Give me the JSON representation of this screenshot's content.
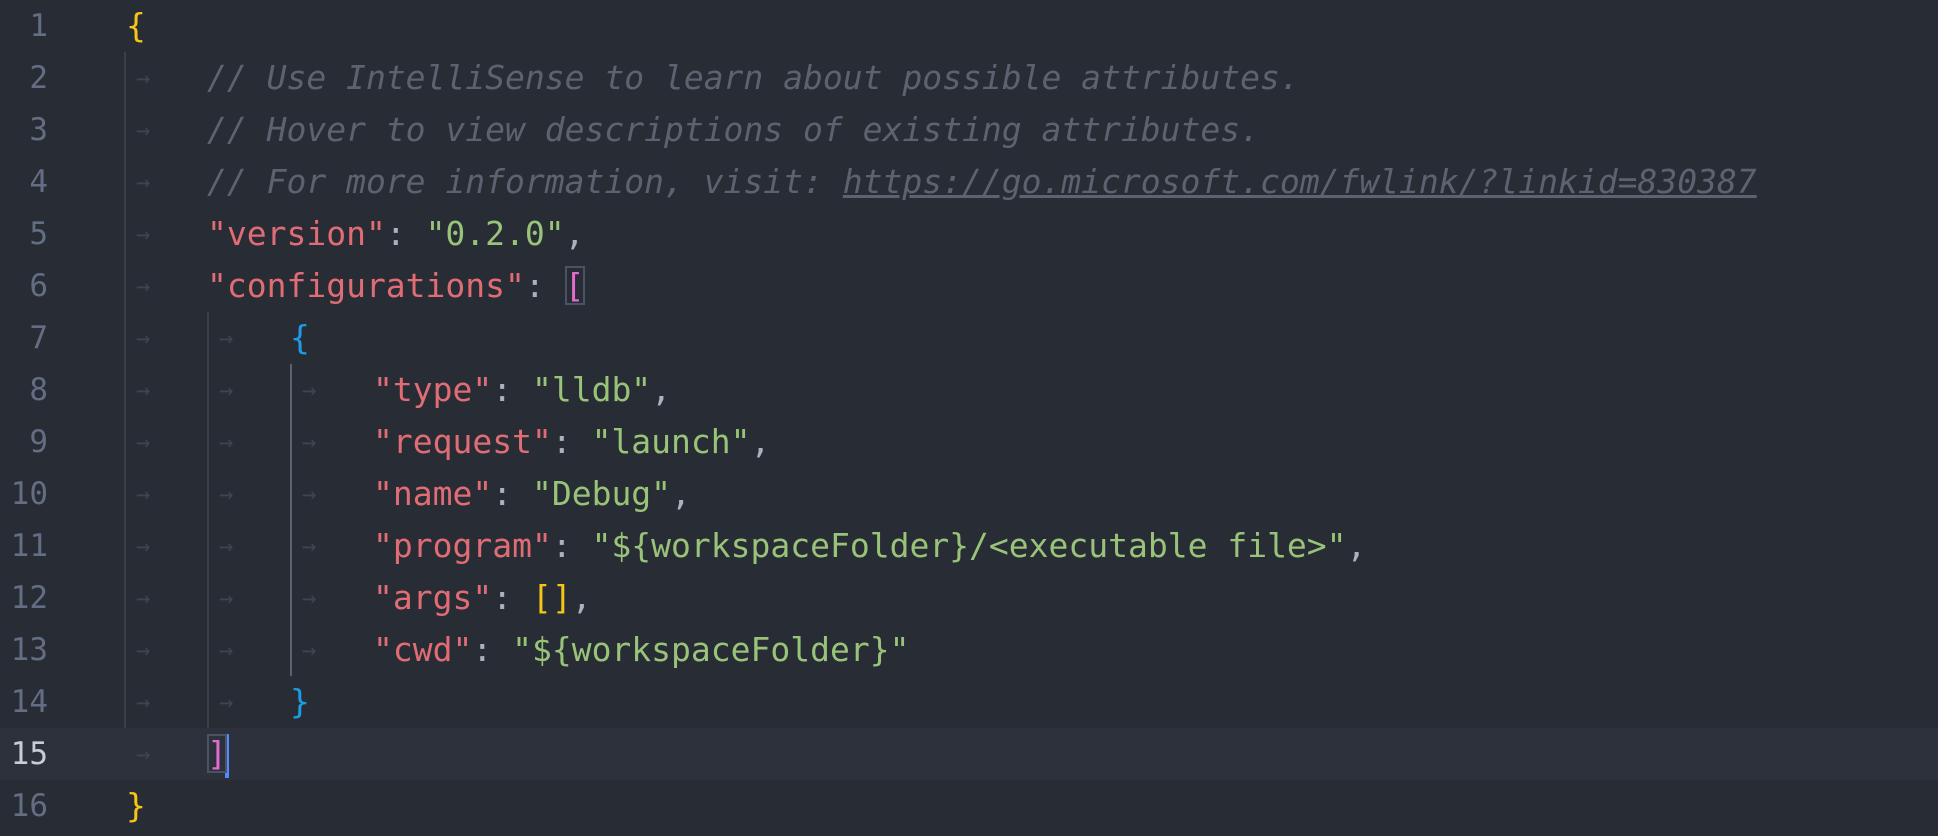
{
  "editor": {
    "colors": {
      "background": "#282c34",
      "current_line": "#2c313c",
      "key": "#e06c75",
      "string": "#98c379",
      "comment": "#5c6370",
      "brace_level1": "#f5c518",
      "brace_level2": "#e06cce",
      "brace_level3": "#1e9be6",
      "cursor": "#528bff"
    },
    "current_line_number": 15,
    "line_numbers": [
      "1",
      "2",
      "3",
      "4",
      "5",
      "6",
      "7",
      "8",
      "9",
      "10",
      "11",
      "12",
      "13",
      "14",
      "15",
      "16"
    ],
    "lines": {
      "l1_open": "{",
      "l2_comment": "// Use IntelliSense to learn about possible attributes.",
      "l3_comment": "// Hover to view descriptions of existing attributes.",
      "l4_comment_prefix": "// For more information, visit: ",
      "l4_link": "https://go.microsoft.com/fwlink/?linkid=830387",
      "l5_key": "\"version\"",
      "l5_value": "\"0.2.0\"",
      "l6_key": "\"configurations\"",
      "l6_bracket": "[",
      "l7_open": "{",
      "l8_key": "\"type\"",
      "l8_value": "\"lldb\"",
      "l9_key": "\"request\"",
      "l9_value": "\"launch\"",
      "l10_key": "\"name\"",
      "l10_value": "\"Debug\"",
      "l11_key": "\"program\"",
      "l11_value": "\"${workspaceFolder}/<executable file>\"",
      "l12_key": "\"args\"",
      "l12_value": "[]",
      "l13_key": "\"cwd\"",
      "l13_value": "\"${workspaceFolder}\"",
      "l14_close": "}",
      "l15_bracket": "]",
      "l16_close": "}"
    },
    "punctuation": {
      "colon": ": ",
      "comma": ","
    },
    "whitespace_marker": "→"
  }
}
